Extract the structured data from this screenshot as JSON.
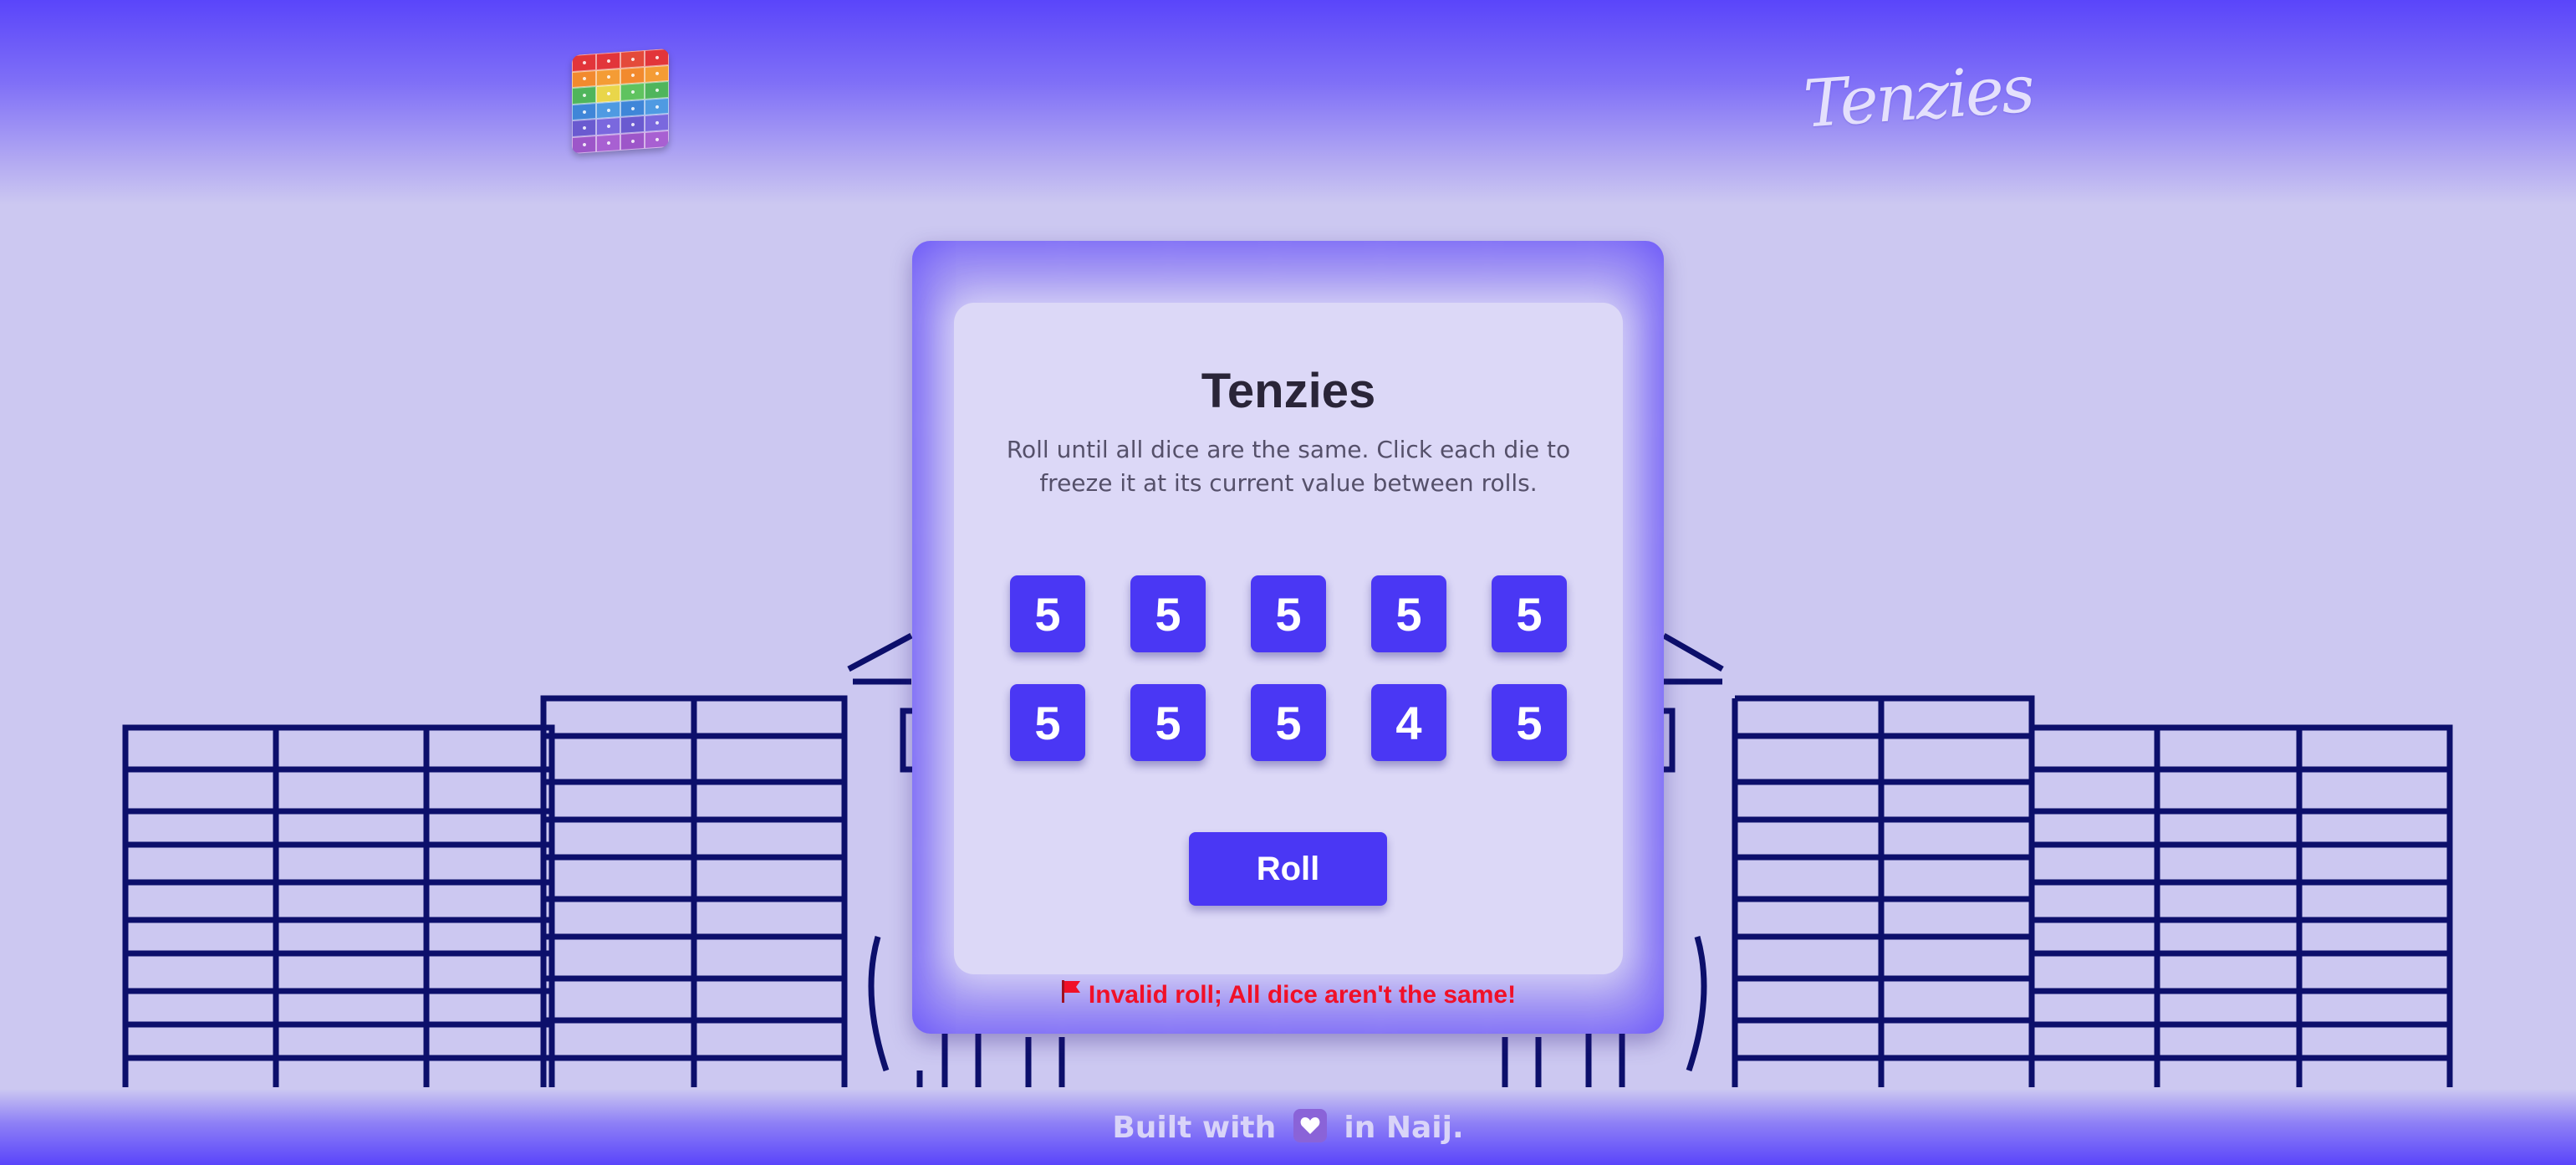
{
  "header": {
    "logo_icon": "rainbow-dice-cube-icon",
    "brand": "Tenzies"
  },
  "game": {
    "title": "Tenzies",
    "description": "Roll until all dice are the same. Click each die to freeze it at its current value between rolls.",
    "dice": [
      "5",
      "5",
      "5",
      "5",
      "5",
      "5",
      "5",
      "5",
      "4",
      "5"
    ],
    "roll_label": "Roll",
    "status_icon": "red-flag-icon",
    "status_message": "Invalid roll; All dice aren't the same!"
  },
  "footer": {
    "prefix": "Built with",
    "heart_icon": "purple-heart-icon",
    "suffix": "in Naij."
  },
  "colors": {
    "accent": "#4a37f4",
    "header_top": "#5a45fa",
    "background": "#ccc8f1",
    "status_error": "#f01028"
  }
}
